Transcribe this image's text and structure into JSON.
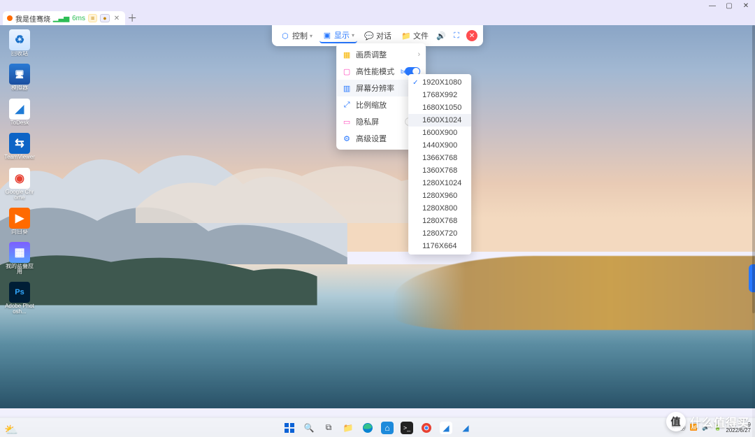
{
  "titlebar": {
    "min": "—",
    "max": "▢",
    "close": "✕"
  },
  "tab": {
    "title": "我是佳骞烧",
    "latency": "6ms"
  },
  "ctrlbar": {
    "control": "控制",
    "display": "显示",
    "chat": "对话",
    "file": "文件"
  },
  "display_menu": {
    "quality": "画质调整",
    "hiperf": "高性能模式",
    "hiperf_badge": "beta",
    "resolution": "屏幕分辨率",
    "scale": "比例缩放",
    "privacy": "隐私屏",
    "advanced": "高级设置"
  },
  "resolutions": [
    "1920X1080",
    "1768X992",
    "1680X1050",
    "1600X1024",
    "1600X900",
    "1440X900",
    "1366X768",
    "1360X768",
    "1280X1024",
    "1280X960",
    "1280X800",
    "1280X768",
    "1280X720",
    "1176X664"
  ],
  "selected_resolution": "1920X1080",
  "hover_resolution": "1600X1024",
  "desktop_icons": [
    {
      "id": "recycle",
      "label": "回收站",
      "bg": "linear-gradient(#eaf3ff,#cde4ff)",
      "glyph": "♻",
      "fg": "#1a71c9"
    },
    {
      "id": "thispc",
      "label": "模拟器",
      "bg": "linear-gradient(#2a7ad4,#1a4fa0)",
      "glyph": "🖥",
      "fg": "#fff"
    },
    {
      "id": "todesk",
      "label": "ToDesk",
      "bg": "#ffffff",
      "glyph": "◢",
      "fg": "#1f7bd6"
    },
    {
      "id": "teamviewer",
      "label": "TeamViewer",
      "bg": "#0d64c6",
      "glyph": "⇆",
      "fg": "#fff"
    },
    {
      "id": "chrome",
      "label": "Google Chrome",
      "bg": "#ffffff",
      "glyph": "◉",
      "fg": "#e74133"
    },
    {
      "id": "sunflower",
      "label": "向日葵",
      "bg": "#ff6a00",
      "glyph": "▶",
      "fg": "#fff"
    },
    {
      "id": "apps",
      "label": "我的蓝叠应用",
      "bg": "linear-gradient(#7d5fff,#5aa2ff)",
      "glyph": "▦",
      "fg": "#fff"
    },
    {
      "id": "photoshop",
      "label": "Adobe Photosh...",
      "bg": "#001e36",
      "glyph": "Ps",
      "fg": "#31a8ff"
    }
  ],
  "taskbar": {
    "icons": [
      "start",
      "search",
      "taskview",
      "explorer",
      "edge",
      "store",
      "terminal",
      "chrome",
      "todesk2",
      "sunflower2"
    ]
  },
  "tray": {
    "time": "9",
    "date": "2022/6/27"
  },
  "watermark": "什么值得买"
}
